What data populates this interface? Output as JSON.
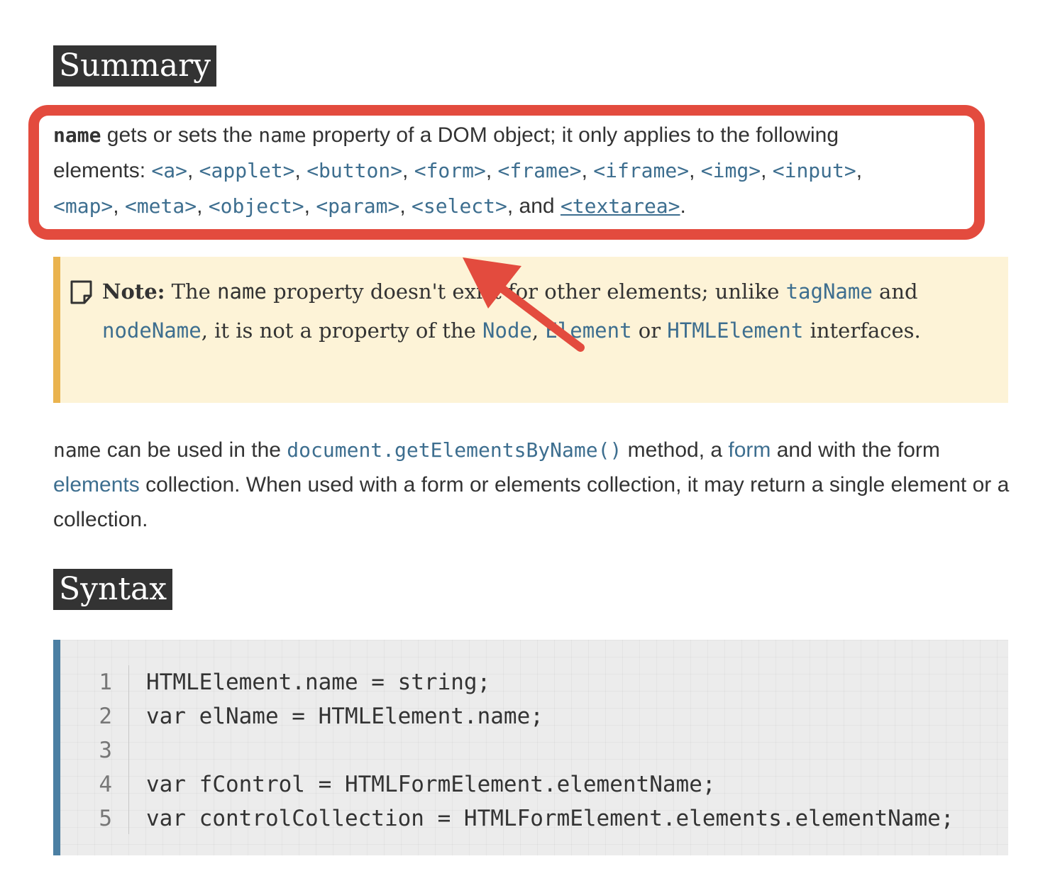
{
  "headings": {
    "summary": "Summary",
    "syntax": "Syntax"
  },
  "summary": {
    "prop": "name",
    "t1": " gets or sets the ",
    "prop2": "name",
    "t2": " property of a DOM object; it only applies to the following",
    "t3": "elements: ",
    "elements": [
      "<a>",
      "<applet>",
      "<button>",
      "<form>",
      "<frame>",
      "<iframe>",
      "<img>",
      "<input>",
      "<map>",
      "<meta>",
      "<object>",
      "<param>",
      "<select>"
    ],
    "sep": ", ",
    "and": ", and ",
    "last": "<textarea>",
    "end": "."
  },
  "note": {
    "label": "Note:",
    "t1": " The ",
    "prop": "name",
    "t2": " property doesn't exist for other elements; unlike ",
    "link1": "tagName",
    "t3": " and ",
    "link2": "nodeName",
    "t4": ", it is not a property of the ",
    "link3": "Node",
    "t5": ", ",
    "link4": "Element",
    "t6": " or ",
    "link5": "HTMLElement",
    "t7": " interfaces."
  },
  "para": {
    "prop": "name",
    "t1": " can be used in the ",
    "link1": "document.getElementsByName()",
    "t2": " method, a ",
    "link2": "form",
    "t3": " and with the form ",
    "link3": "elements",
    "t4": " collection. When used with a form or elements collection, it may return a single element or a collection."
  },
  "code": {
    "lines": [
      {
        "n": "1",
        "src": "HTMLElement.name = string;"
      },
      {
        "n": "2",
        "src": "var elName = HTMLElement.name;"
      },
      {
        "n": "3",
        "src": ""
      },
      {
        "n": "4",
        "src": "var fControl = HTMLFormElement.elementName;"
      },
      {
        "n": "5",
        "src": "var controlCollection = HTMLFormElement.elements.elementName;"
      }
    ]
  },
  "colors": {
    "heading_bg": "#333333",
    "link": "#3d6e8f",
    "highlight": "#e34b3e",
    "note_bg": "#fdf3d7",
    "note_border": "#eab34e",
    "code_border": "#4b7fa3"
  },
  "icons": {
    "note": "note-page-icon",
    "annotation": "red-arrow-icon"
  }
}
